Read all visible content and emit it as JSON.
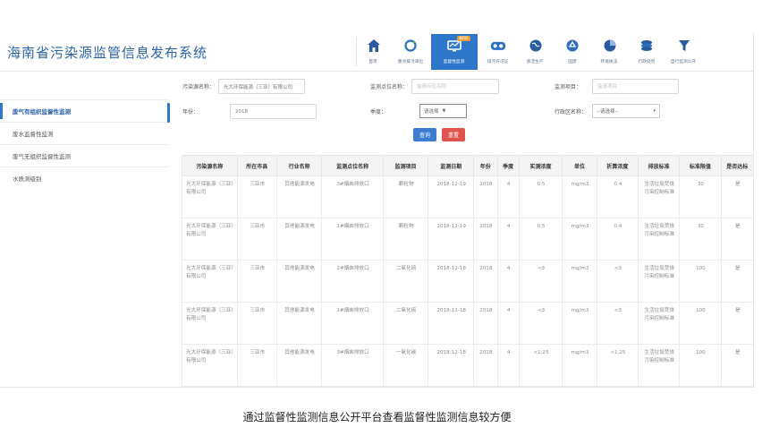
{
  "app": {
    "title": "海南省污染源监管信息发布系统"
  },
  "nav": [
    {
      "label": "首页",
      "icon": "home-icon",
      "active": false
    },
    {
      "label": "重点排污单位",
      "icon": "refresh-icon",
      "active": false
    },
    {
      "label": "监督性监测",
      "icon": "monitor-icon",
      "active": true,
      "badge": "NEW"
    },
    {
      "label": "排污许可证",
      "icon": "license-icon",
      "active": false
    },
    {
      "label": "清洁生产",
      "icon": "globe-icon",
      "active": false
    },
    {
      "label": "固废",
      "icon": "recycle-icon",
      "active": false
    },
    {
      "label": "环境执法",
      "icon": "pie-icon",
      "active": false
    },
    {
      "label": "行政处罚",
      "icon": "layers-icon",
      "active": false
    },
    {
      "label": "自行监测公开",
      "icon": "filter-icon",
      "active": false
    }
  ],
  "sidebar": {
    "items": [
      {
        "label": "废气有组织监督性监测",
        "active": true
      },
      {
        "label": "废水监督性监测",
        "active": false
      },
      {
        "label": "废气无组织监督性监测",
        "active": false
      },
      {
        "label": "水质测级别",
        "active": false
      }
    ]
  },
  "form": {
    "enterprise_label": "污染源名称：",
    "enterprise_value": "光大环保能源（三亚）有限公司",
    "point_label": "监测点位名称：",
    "point_placeholder": "监测点位名称",
    "item_label": "监测项目：",
    "item_placeholder": "监测项目",
    "year_label": "年份：",
    "year_value": "2018",
    "quarter_label": "季度：",
    "quarter_value": "请选择",
    "region_label": "行政区名称：",
    "region_value": "--请选择--",
    "query_label": "查询",
    "reset_label": "重置"
  },
  "table": {
    "headers": [
      "污染源名称",
      "所在市县",
      "行业名称",
      "监测点位名称",
      "监测项目",
      "监测日期",
      "年份",
      "季度",
      "实测浓度",
      "单位",
      "折算浓度",
      "排放标准",
      "标准限值",
      "是否达标"
    ],
    "rows": [
      [
        "光大环保能源（三亚）有限公司",
        "三亚市",
        "其他能源发电",
        "3#烟囱排放口",
        "颗粒物",
        "2018-12-19",
        "2018",
        "4",
        "0.5",
        "mg/m3",
        "0.4",
        "生活垃圾焚烧污染控制标准",
        "30",
        "是"
      ],
      [
        "光大环保能源（三亚）有限公司",
        "三亚市",
        "其他能源发电",
        "1#烟囱排放口",
        "颗粒物",
        "2018-12-19",
        "2018",
        "4",
        "0.5",
        "mg/m3",
        "0.4",
        "生活垃圾焚烧污染控制标准",
        "30",
        "是"
      ],
      [
        "光大环保能源（三亚）有限公司",
        "三亚市",
        "其他能源发电",
        "2#烟囱排放口",
        "二氧化硫",
        "2018-12-18",
        "2018",
        "4",
        "<3",
        "mg/m3",
        "<3",
        "生活垃圾焚烧污染控制标准",
        "100",
        "是"
      ],
      [
        "光大环保能源（三亚）有限公司",
        "三亚市",
        "其他能源发电",
        "1#烟囱排放口",
        "二氧化硫",
        "2018-12-18",
        "2018",
        "4",
        "<3",
        "mg/m3",
        "<3",
        "生活垃圾焚烧污染控制标准",
        "100",
        "是"
      ],
      [
        "光大环保能源（三亚）有限公司",
        "三亚市",
        "其他能源发电",
        "3#烟囱排放口",
        "一氧化碳",
        "2018-12-18",
        "2018",
        "4",
        "<1.25",
        "mg/m3",
        "<1.25",
        "生活垃圾焚烧污染控制标准",
        "100",
        "是"
      ]
    ]
  },
  "caption": "通过监督性监测信息公开平台查看监督性监测信息较方便",
  "colors": {
    "accent": "#2d76c9",
    "title": "#2a62a8",
    "reset": "#e0534f",
    "badge": "#e8a13a"
  }
}
